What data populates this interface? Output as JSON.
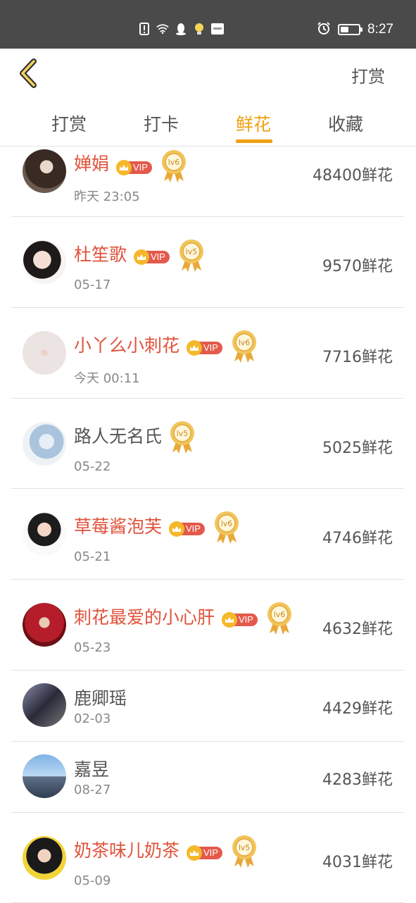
{
  "status_bar": {
    "time": "8:27",
    "battery_level": 0.45
  },
  "header": {
    "back_icon": "chevron-left-icon",
    "action_label": "打赏"
  },
  "tabs": [
    {
      "label": "打赏",
      "active": false
    },
    {
      "label": "打卡",
      "active": false
    },
    {
      "label": "鲜花",
      "active": true
    },
    {
      "label": "收藏",
      "active": false
    }
  ],
  "colors": {
    "accent": "#f0a010",
    "vip_name": "#e0523a",
    "vip_badge": "#e35a4b",
    "crown": "#f5b82a",
    "medal": "#f2c45a"
  },
  "list": [
    {
      "name": "婵娟",
      "date": "昨天 23:05",
      "amount": "48400鲜花",
      "vip": true,
      "level": "lv6"
    },
    {
      "name": "杜笙歌",
      "date": "05-17",
      "amount": "9570鲜花",
      "vip": true,
      "level": "lv5"
    },
    {
      "name": "小丫么小刺花",
      "date": "今天 00:11",
      "amount": "7716鲜花",
      "vip": true,
      "level": "lv6"
    },
    {
      "name": "路人无名氏",
      "date": "05-22",
      "amount": "5025鲜花",
      "vip": false,
      "level": "lv5"
    },
    {
      "name": "草莓酱泡芙",
      "date": "05-21",
      "amount": "4746鲜花",
      "vip": true,
      "level": "lv6"
    },
    {
      "name": "刺花最爱的小心肝",
      "date": "05-23",
      "amount": "4632鲜花",
      "vip": true,
      "level": "lv6"
    },
    {
      "name": "鹿卿瑶",
      "date": "02-03",
      "amount": "4429鲜花",
      "vip": false,
      "level": null
    },
    {
      "name": "嘉昱",
      "date": "08-27",
      "amount": "4283鲜花",
      "vip": false,
      "level": null
    },
    {
      "name": "奶茶味儿奶茶",
      "date": "05-09",
      "amount": "4031鲜花",
      "vip": true,
      "level": "lv5"
    }
  ],
  "vip_label": "VIP"
}
